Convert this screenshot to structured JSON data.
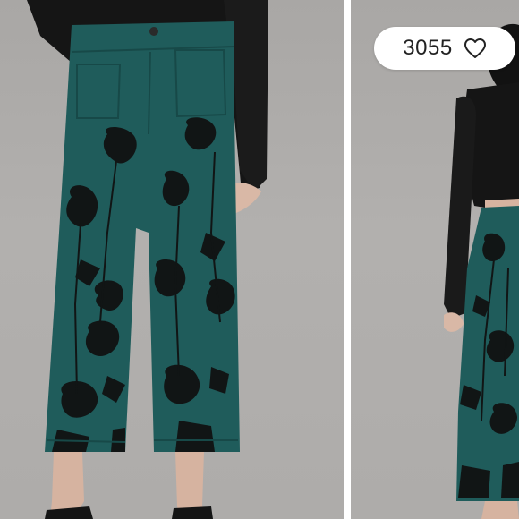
{
  "listing": {
    "like_count": "3055",
    "like_icon": "heart-outline-icon",
    "photos": [
      {
        "subject": "front-view"
      },
      {
        "subject": "side-view"
      }
    ],
    "colors": {
      "pant_teal": "#1f5c5b",
      "floral_print": "#111515",
      "backdrop": "#aeacaa",
      "top_black": "#151515"
    }
  }
}
